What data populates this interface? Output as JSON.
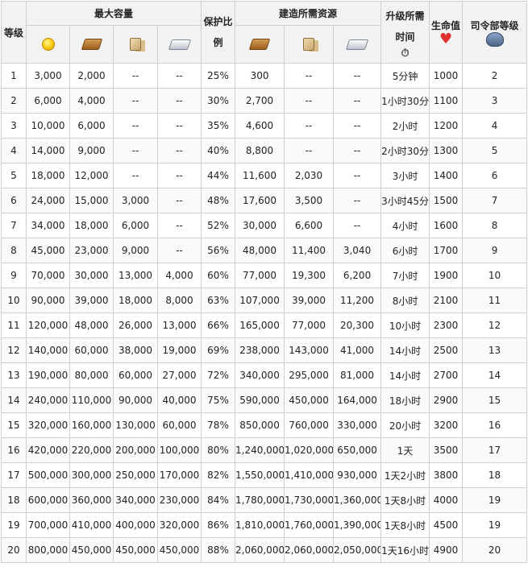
{
  "headers": {
    "level": "等级",
    "max_capacity": "最大容量",
    "protect_ratio": "保护比例",
    "build_resources": "建造所需资源",
    "upgrade_time": "升级所需时间",
    "health": "生命值",
    "hq_level": "司令部等级"
  },
  "icons": {
    "cap_gold": "gold-coin-icon",
    "cap_lumber": "lumber-icon",
    "cap_stone": "stone-icon",
    "cap_iron": "iron-ingot-icon",
    "res_lumber": "lumber-icon",
    "res_stone": "stone-icon",
    "res_iron": "iron-ingot-icon",
    "time": "stopwatch-icon",
    "health": "heart-icon",
    "hq": "headquarters-icon"
  },
  "rows": [
    [
      "1",
      "3,000",
      "2,000",
      "--",
      "--",
      "25%",
      "300",
      "--",
      "--",
      "5分钟",
      "1000",
      "2"
    ],
    [
      "2",
      "6,000",
      "4,000",
      "--",
      "--",
      "30%",
      "2,700",
      "--",
      "--",
      "1小时30分",
      "1100",
      "3"
    ],
    [
      "3",
      "10,000",
      "6,000",
      "--",
      "--",
      "35%",
      "4,600",
      "--",
      "--",
      "2小时",
      "1200",
      "4"
    ],
    [
      "4",
      "14,000",
      "9,000",
      "--",
      "--",
      "40%",
      "8,800",
      "--",
      "--",
      "2小时30分",
      "1300",
      "5"
    ],
    [
      "5",
      "18,000",
      "12,000",
      "--",
      "--",
      "44%",
      "11,600",
      "2,030",
      "--",
      "3小时",
      "1400",
      "6"
    ],
    [
      "6",
      "24,000",
      "15,000",
      "3,000",
      "--",
      "48%",
      "17,600",
      "3,500",
      "--",
      "3小时45分",
      "1500",
      "7"
    ],
    [
      "7",
      "34,000",
      "18,000",
      "6,000",
      "--",
      "52%",
      "30,000",
      "6,600",
      "--",
      "4小时",
      "1600",
      "8"
    ],
    [
      "8",
      "45,000",
      "23,000",
      "9,000",
      "--",
      "56%",
      "48,000",
      "11,400",
      "3,040",
      "6小时",
      "1700",
      "9"
    ],
    [
      "9",
      "70,000",
      "30,000",
      "13,000",
      "4,000",
      "60%",
      "77,000",
      "19,300",
      "6,200",
      "7小时",
      "1900",
      "10"
    ],
    [
      "10",
      "90,000",
      "39,000",
      "18,000",
      "8,000",
      "63%",
      "107,000",
      "39,000",
      "11,200",
      "8小时",
      "2100",
      "11"
    ],
    [
      "11",
      "120,000",
      "48,000",
      "26,000",
      "13,000",
      "66%",
      "165,000",
      "77,000",
      "20,300",
      "10小时",
      "2300",
      "12"
    ],
    [
      "12",
      "140,000",
      "60,000",
      "38,000",
      "19,000",
      "69%",
      "238,000",
      "143,000",
      "41,000",
      "14小时",
      "2500",
      "13"
    ],
    [
      "13",
      "190,000",
      "80,000",
      "60,000",
      "27,000",
      "72%",
      "340,000",
      "295,000",
      "81,000",
      "14小时",
      "2700",
      "14"
    ],
    [
      "14",
      "240,000",
      "110,000",
      "90,000",
      "40,000",
      "75%",
      "590,000",
      "450,000",
      "164,000",
      "18小时",
      "2900",
      "15"
    ],
    [
      "15",
      "320,000",
      "160,000",
      "130,000",
      "60,000",
      "78%",
      "850,000",
      "760,000",
      "330,000",
      "20小时",
      "3200",
      "16"
    ],
    [
      "16",
      "420,000",
      "220,000",
      "200,000",
      "100,000",
      "80%",
      "1,240,000",
      "1,020,000",
      "650,000",
      "1天",
      "3500",
      "17"
    ],
    [
      "17",
      "500,000",
      "300,000",
      "250,000",
      "170,000",
      "82%",
      "1,550,000",
      "1,410,000",
      "930,000",
      "1天2小时",
      "3800",
      "18"
    ],
    [
      "18",
      "600,000",
      "360,000",
      "340,000",
      "230,000",
      "84%",
      "1,780,000",
      "1,730,000",
      "1,360,000",
      "1天8小时",
      "4000",
      "19"
    ],
    [
      "19",
      "700,000",
      "410,000",
      "400,000",
      "320,000",
      "86%",
      "1,810,000",
      "1,760,000",
      "1,390,000",
      "1天8小时",
      "4500",
      "19"
    ],
    [
      "20",
      "800,000",
      "450,000",
      "450,000",
      "450,000",
      "88%",
      "2,060,000",
      "2,060,000",
      "2,050,000",
      "1天16小时",
      "4900",
      "20"
    ]
  ]
}
